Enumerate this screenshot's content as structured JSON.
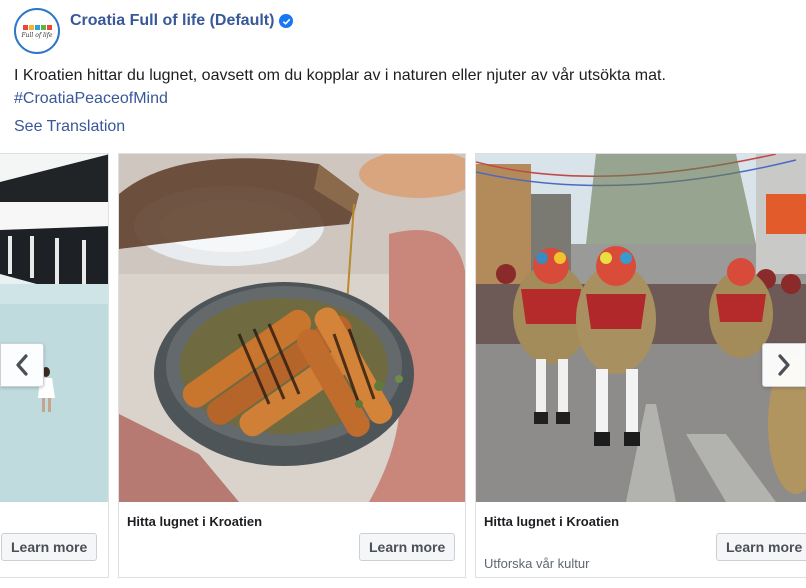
{
  "page": {
    "name": "Croatia Full of life (Default)",
    "avatar_text": "Full of life",
    "verified": true
  },
  "post": {
    "text": "I Kroatien hittar du lugnet, oavsett om du kopplar av i naturen eller njuter av vår utsökta mat.",
    "hashtag": "#CroatiaPeaceofMind",
    "see_translation": "See Translation"
  },
  "carousel": {
    "cards": [
      {
        "image": "woman-walking-on-white-beach-under-modern-building",
        "title": "",
        "description": "",
        "button": "Learn more"
      },
      {
        "image": "grilled-vegetables-with-olive-oil-pour",
        "title": "Hitta lugnet i Kroatien",
        "description": "",
        "button": "Learn more"
      },
      {
        "image": "traditional-costumed-bell-ringers-street-parade",
        "title": "Hitta lugnet i Kroatien",
        "description": "Utforska vår kultur",
        "button": "Learn more"
      }
    ],
    "prev_icon": "chevron-left-icon",
    "next_icon": "chevron-right-icon"
  },
  "colors": {
    "link": "#385898",
    "verified": "#1877f2"
  }
}
